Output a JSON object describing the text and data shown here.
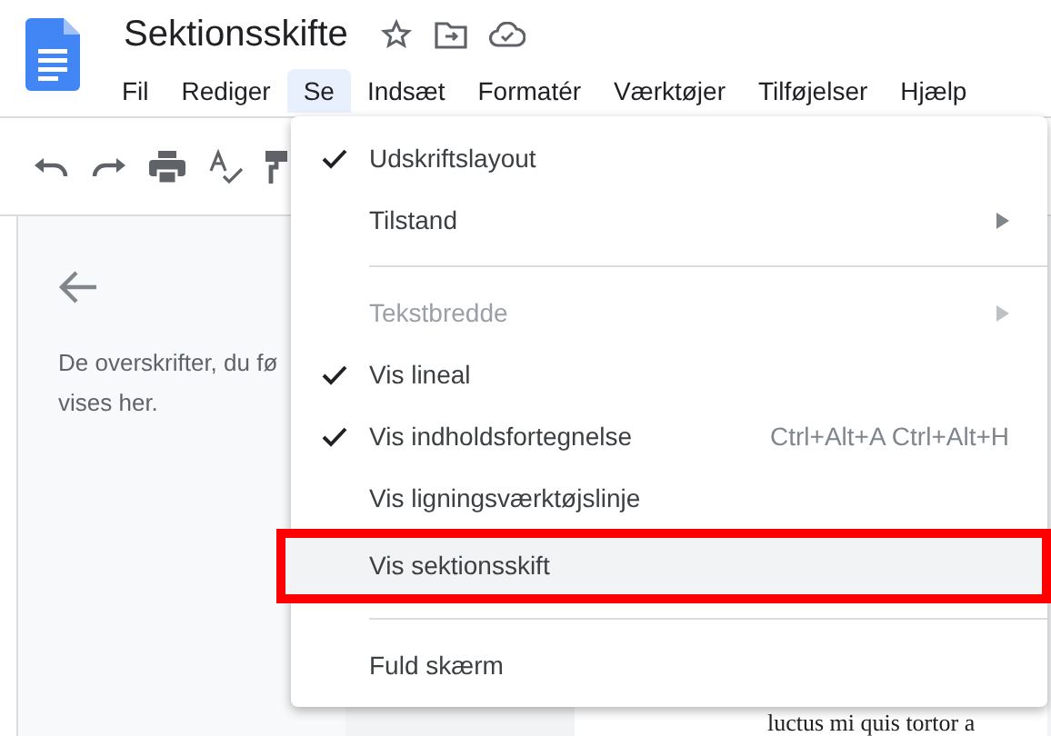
{
  "document": {
    "title": "Sektionsskifte"
  },
  "menubar": [
    {
      "label": "Fil",
      "selected": false
    },
    {
      "label": "Rediger",
      "selected": false
    },
    {
      "label": "Se",
      "selected": true
    },
    {
      "label": "Indsæt",
      "selected": false
    },
    {
      "label": "Formatér",
      "selected": false
    },
    {
      "label": "Værktøjer",
      "selected": false
    },
    {
      "label": "Tilføjelser",
      "selected": false
    },
    {
      "label": "Hjælp",
      "selected": false
    }
  ],
  "outline_panel": {
    "message": "De overskrifter, du fø\nvises her."
  },
  "document_fragments": [
    "luctus mi quis tortor a"
  ],
  "menu": [
    {
      "kind": "item",
      "label": "Udskriftslayout",
      "checked": true,
      "disabled": false,
      "submenu": false,
      "selected": false,
      "annotated": false
    },
    {
      "kind": "item",
      "label": "Tilstand",
      "checked": false,
      "disabled": false,
      "submenu": true,
      "selected": false,
      "annotated": false
    },
    {
      "kind": "divider"
    },
    {
      "kind": "item",
      "label": "Tekstbredde",
      "checked": false,
      "disabled": true,
      "submenu": true,
      "selected": false,
      "annotated": false
    },
    {
      "kind": "item",
      "label": "Vis lineal",
      "checked": true,
      "disabled": false,
      "submenu": false,
      "selected": false,
      "annotated": false
    },
    {
      "kind": "item",
      "label": "Vis indholdsfortegnelse",
      "checked": true,
      "disabled": false,
      "submenu": false,
      "shortcut": "Ctrl+Alt+A Ctrl+Alt+H",
      "selected": false,
      "annotated": false
    },
    {
      "kind": "item",
      "label": "Vis ligningsværktøjslinje",
      "checked": false,
      "disabled": false,
      "submenu": false,
      "selected": false,
      "annotated": false
    },
    {
      "kind": "item",
      "label": "Vis sektionsskift",
      "checked": false,
      "disabled": false,
      "submenu": false,
      "selected": true,
      "annotated": true
    },
    {
      "kind": "divider"
    },
    {
      "kind": "item",
      "label": "Fuld skærm",
      "checked": false,
      "disabled": false,
      "submenu": false,
      "selected": false,
      "annotated": false
    }
  ]
}
